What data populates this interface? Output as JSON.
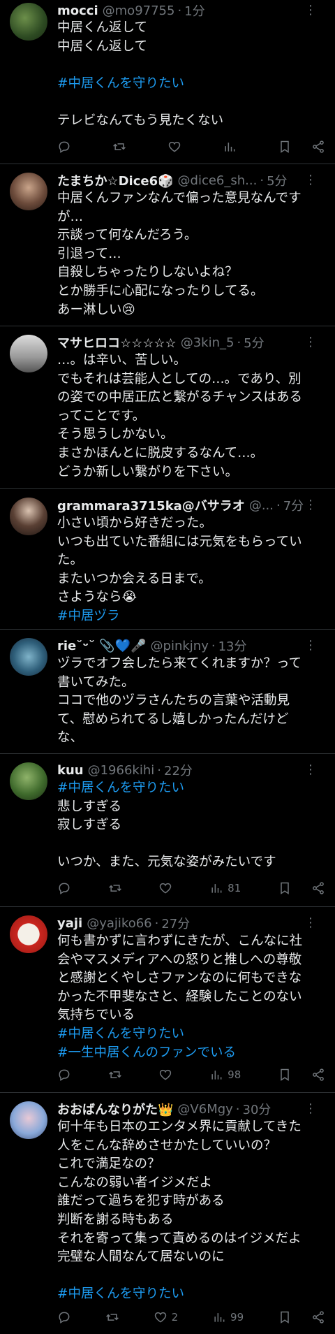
{
  "posts": [
    {
      "name": "mocci",
      "handle": "@mo97755",
      "time": "1分",
      "lines": [
        {
          "text": "中居くん返して"
        },
        {
          "text": "中居くん返して"
        },
        {
          "text": ""
        },
        {
          "text": "#中居くんを守りたい",
          "tag": true
        },
        {
          "text": ""
        },
        {
          "text": "テレビなんてもう見たくない"
        }
      ],
      "views": "",
      "likes": ""
    },
    {
      "name": "たまちか☆Dice6🎲",
      "handle": "@dice6_sh...",
      "time": "5分",
      "lines": [
        {
          "text": "中居くんファンなんで偏った意見なんです"
        },
        {
          "text": "が…"
        },
        {
          "text": "示談って何なんだろう。"
        },
        {
          "text": "引退って…"
        },
        {
          "text": "自殺しちゃったりしないよね？"
        },
        {
          "text": "とか勝手に心配になったりしてる。"
        },
        {
          "text": "あー淋しい😢"
        }
      ]
    },
    {
      "name": "マサヒロコ☆☆☆☆☆",
      "handle": "@3kin_5",
      "time": "5分",
      "lines": [
        {
          "text": "…。は辛い、苦しい。"
        },
        {
          "text": "でもそれは芸能人としての…。であり、別"
        },
        {
          "text": "の姿での中居正広と繋がるチャンスはある"
        },
        {
          "text": "ってことです。"
        },
        {
          "text": "そう思うしかない。"
        },
        {
          "text": "まさかほんとに脱皮するなんて…。"
        },
        {
          "text": "どうか新しい繋がりを下さい。"
        }
      ]
    },
    {
      "name": "grammara3715ka@バサラオ",
      "handle": "@...",
      "time": "7分",
      "lines": [
        {
          "text": "小さい頃から好きだった。"
        },
        {
          "text": "いつも出ていた番組には元気をもらってい"
        },
        {
          "text": "た。"
        },
        {
          "text": "またいつか会える日まで。"
        },
        {
          "text": "さようなら😭"
        },
        {
          "text": "#中居ヅラ",
          "tag": true
        }
      ]
    },
    {
      "name": "rie˘ᵕ˘ 📎💙🎤",
      "handle": "@pinkjny",
      "time": "13分",
      "lines": [
        {
          "text": "ヅラでオフ会したら来てくれますか？って"
        },
        {
          "text": "書いてみた。"
        },
        {
          "text": "ココで他のヅラさんたちの言葉や活動見"
        },
        {
          "text": "て、慰められてるし嬉しかったんだけど"
        },
        {
          "text": "な、"
        }
      ]
    },
    {
      "name": "kuu",
      "handle": "@1966kihi",
      "time": "22分",
      "lines": [
        {
          "text": "#中居くんを守りたい",
          "tag": true
        },
        {
          "text": "悲しすぎる"
        },
        {
          "text": "寂しすぎる"
        },
        {
          "text": ""
        },
        {
          "text": "いつか、また、元気な姿がみたいです"
        }
      ],
      "views": "81",
      "likes": ""
    },
    {
      "name": "yaji",
      "handle": "@yajiko66",
      "time": "27分",
      "lines": [
        {
          "text": "何も書かずに言わずにきたが、こんなに社"
        },
        {
          "text": "会やマスメディアへの怒りと推しへの尊敬"
        },
        {
          "text": "と感謝とくやしさファンなのに何もできな"
        },
        {
          "text": "かった不甲斐なさと、経験したことのない"
        },
        {
          "text": "気持ちでいる"
        },
        {
          "text": "#中居くんを守りたい",
          "tag": true
        },
        {
          "text": "#一生中居くんのファンでいる",
          "tag": true
        }
      ],
      "views": "98",
      "likes": ""
    },
    {
      "name": "おおばんなりがた👑",
      "handle": "@V6Mgy",
      "time": "30分",
      "lines": [
        {
          "text": "何十年も日本のエンタメ界に貢献してきた"
        },
        {
          "text": "人をこんな辞めさせかたしていいの？"
        },
        {
          "text": "これで満足なの？"
        },
        {
          "text": "こんなの弱い者イジメだよ"
        },
        {
          "text": "誰だって過ちを犯す時がある"
        },
        {
          "text": "判断を謝る時もある"
        },
        {
          "text": "それを寄って集って責めるのはイジメだよ"
        },
        {
          "text": "完璧な人間なんて居ないのに"
        },
        {
          "text": ""
        },
        {
          "text": " #中居くんを守りたい",
          "tag": true
        }
      ],
      "views": "99",
      "likes": "2"
    }
  ],
  "colors": {
    "link": "#1d9bf0",
    "muted": "#71767b",
    "text": "#e7e9ea",
    "divider": "#2f3336"
  }
}
